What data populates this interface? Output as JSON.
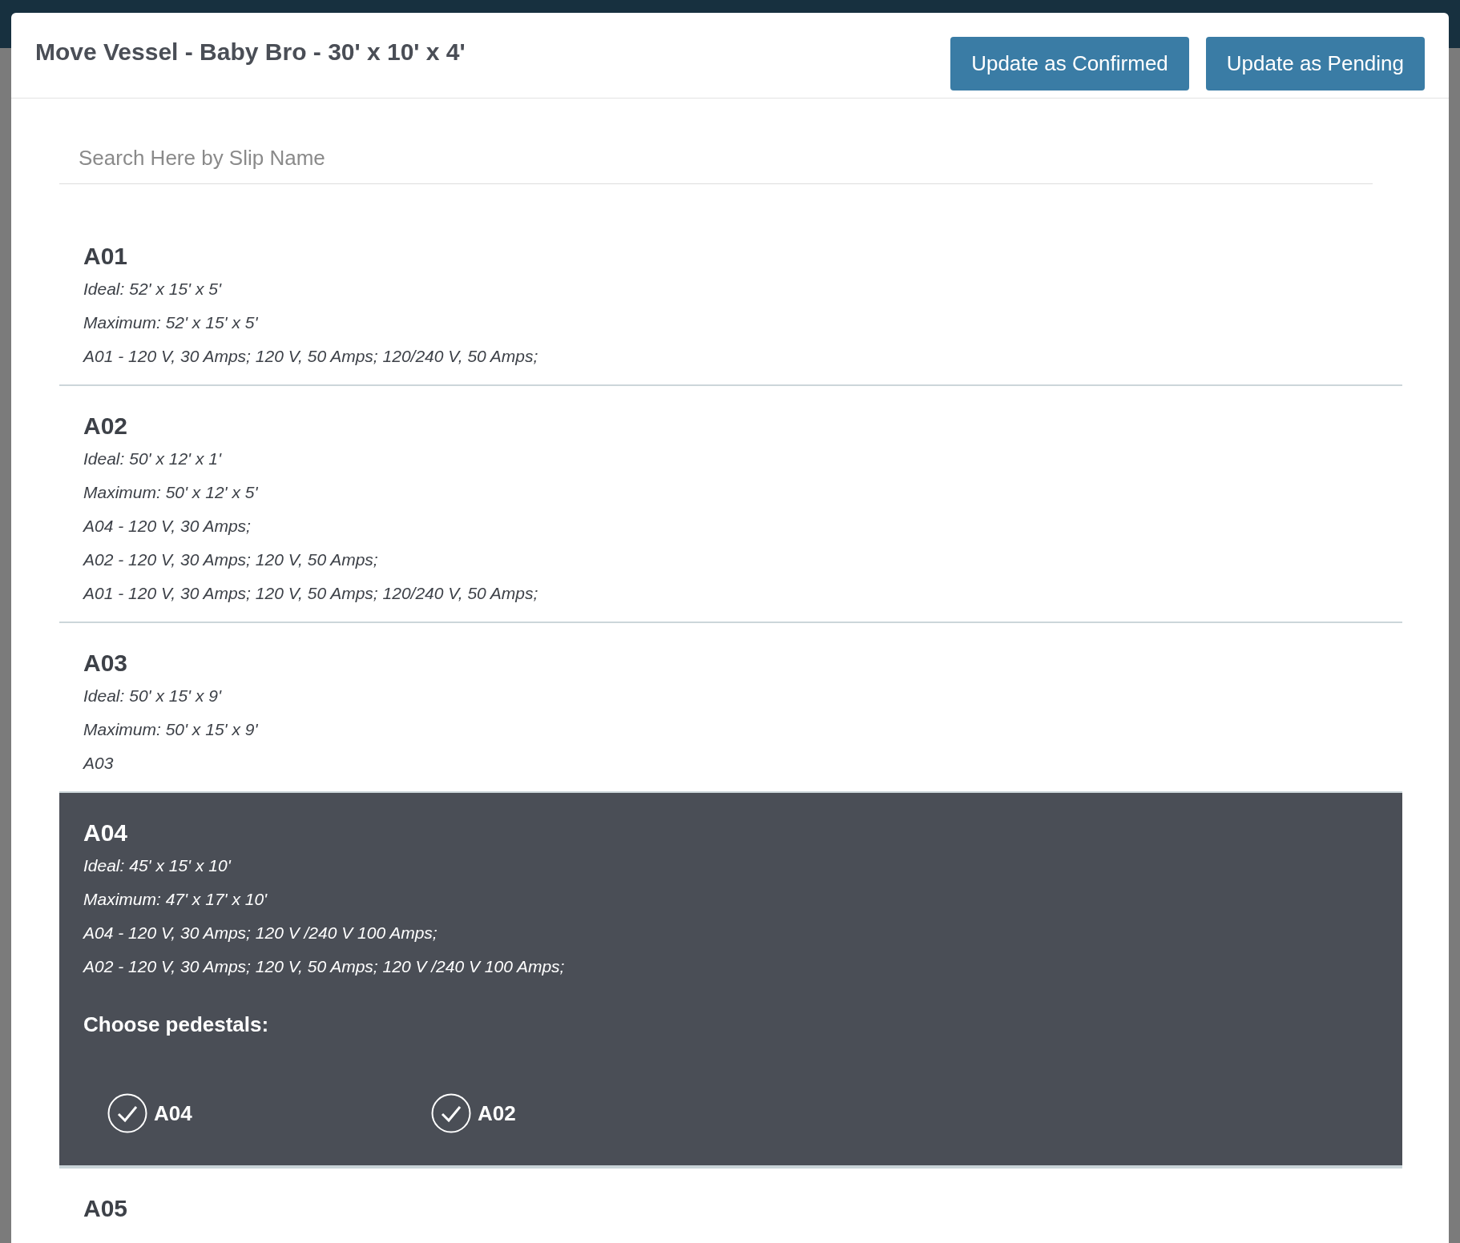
{
  "modal": {
    "title": "Move Vessel - Baby Bro - 30' x 10' x 4'",
    "buttons": [
      {
        "label": "Update as Confirmed"
      },
      {
        "label": "Update as Pending"
      }
    ],
    "search": {
      "placeholder": "Search Here by Slip Name"
    },
    "slips": [
      {
        "name": "A01",
        "selected": false,
        "lines": [
          "Ideal: 52' x 15' x 5'",
          "Maximum: 52' x 15' x 5'",
          "A01 - 120 V, 30 Amps; 120 V, 50 Amps; 120/240 V, 50 Amps;"
        ]
      },
      {
        "name": "A02",
        "selected": false,
        "lines": [
          "Ideal: 50' x 12' x 1'",
          "Maximum: 50' x 12' x 5'",
          "A04 - 120 V, 30 Amps;",
          "A02 - 120 V, 30 Amps; 120 V, 50 Amps;",
          "A01 - 120 V, 30 Amps; 120 V, 50 Amps; 120/240 V, 50 Amps;"
        ]
      },
      {
        "name": "A03",
        "selected": false,
        "lines": [
          "Ideal: 50' x 15' x 9'",
          "Maximum: 50' x 15' x 9'",
          "A03"
        ]
      },
      {
        "name": "A04",
        "selected": true,
        "lines": [
          "Ideal: 45' x 15' x 10'",
          "Maximum: 47' x 17' x 10'",
          "A04 - 120 V, 30 Amps; 120 V /240 V 100 Amps;",
          "A02 - 120 V, 30 Amps; 120 V, 50 Amps; 120 V /240 V 100 Amps;"
        ],
        "pedestals_label": "Choose pedestals:",
        "pedestals": [
          {
            "label": "A04",
            "checked": true
          },
          {
            "label": "A02",
            "checked": true
          }
        ]
      },
      {
        "name": "A05",
        "selected": false
      }
    ]
  }
}
